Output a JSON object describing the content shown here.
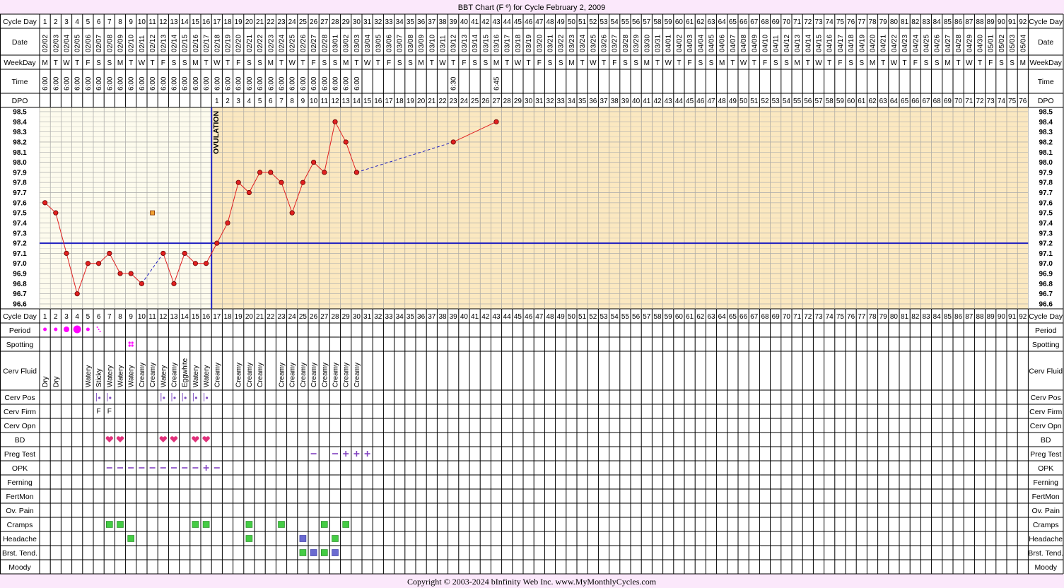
{
  "header": {
    "title": "BBT Chart (F º) for Cycle February 2, 2009"
  },
  "footer": {
    "copyright": "Copyright © 2003-2024 bInfinity Web Inc.    www.MyMonthlyCycles.com"
  },
  "row_labels": {
    "cycle_day": "Cycle Day",
    "date": "Date",
    "weekday": "WeekDay",
    "time": "Time",
    "dpo": "DPO",
    "period": "Period",
    "spotting": "Spotting",
    "cerv_fluid": "Cerv Fluid",
    "cerv_pos": "Cerv Pos",
    "cerv_firm": "Cerv Firm",
    "cerv_opn": "Cerv Opn",
    "bd": "BD",
    "preg_test": "Preg Test",
    "opk": "OPK",
    "ferning": "Ferning",
    "fertmon": "FertMon",
    "ov_pain": "Ov. Pain",
    "cramps": "Cramps",
    "headache": "Headache",
    "brst_tend": "Brst. Tend.",
    "moody": "Moody"
  },
  "ovulation_label": "OVULATION",
  "colors": {
    "background": "#fbe8fb",
    "preov_fill": "#fdfbed",
    "postov_fill": "#fbe8c0",
    "line": "#e02020",
    "coverline": "#2020c0",
    "period": "#ff00ff",
    "heart": "#e0307a",
    "symptom_green": "#44cc44",
    "symptom_blue": "#6a6ad0",
    "opk": "#8040c0"
  },
  "days": {
    "cycle_days": [
      1,
      2,
      3,
      4,
      5,
      6,
      7,
      8,
      9,
      10,
      11,
      12,
      13,
      14,
      15,
      16,
      17,
      18,
      19,
      20,
      21,
      22,
      23,
      24,
      25,
      26,
      27,
      28,
      29,
      30,
      31,
      32,
      33,
      34,
      35,
      36,
      37,
      38,
      39,
      40,
      41,
      42,
      43,
      44,
      45,
      46,
      47,
      48,
      49,
      50,
      51,
      52,
      53,
      54,
      55,
      56,
      57,
      58,
      59,
      60,
      61,
      62,
      63,
      64,
      65,
      66,
      67,
      68,
      69,
      70,
      71,
      72,
      73,
      74,
      75,
      76,
      77,
      78,
      79,
      80,
      81,
      82,
      83,
      84,
      85,
      86,
      87,
      88,
      89,
      90,
      91,
      92
    ],
    "dates": [
      "02/02",
      "02/03",
      "02/04",
      "02/05",
      "02/06",
      "02/07",
      "02/08",
      "02/09",
      "02/10",
      "02/11",
      "02/12",
      "02/13",
      "02/14",
      "02/15",
      "02/16",
      "02/17",
      "02/18",
      "02/19",
      "02/20",
      "02/21",
      "02/22",
      "02/23",
      "02/24",
      "02/25",
      "02/26",
      "02/27",
      "02/28",
      "03/01",
      "03/02",
      "03/03",
      "03/04",
      "03/05",
      "03/06",
      "03/07",
      "03/08",
      "03/09",
      "03/10",
      "03/11",
      "03/12",
      "03/13",
      "03/14",
      "03/15",
      "03/16",
      "03/17",
      "03/18",
      "03/19",
      "03/20",
      "03/21",
      "03/22",
      "03/23",
      "03/24",
      "03/25",
      "03/26",
      "03/27",
      "03/28",
      "03/29",
      "03/30",
      "03/31",
      "04/01",
      "04/02",
      "04/03",
      "04/04",
      "04/05",
      "04/06",
      "04/07",
      "04/08",
      "04/09",
      "04/10",
      "04/11",
      "04/12",
      "04/13",
      "04/14",
      "04/15",
      "04/16",
      "04/17",
      "04/18",
      "04/19",
      "04/20",
      "04/21",
      "04/22",
      "04/23",
      "04/24",
      "04/25",
      "04/26",
      "04/27",
      "04/28",
      "04/29",
      "04/30",
      "05/01",
      "05/02",
      "05/03",
      "05/04"
    ],
    "weekdays": [
      "M",
      "T",
      "W",
      "T",
      "F",
      "S",
      "S",
      "M",
      "T",
      "W",
      "T",
      "F",
      "S",
      "S",
      "M",
      "T",
      "W",
      "T",
      "F",
      "S",
      "S",
      "M",
      "T",
      "W",
      "T",
      "F",
      "S",
      "S",
      "M",
      "T",
      "W",
      "T",
      "F",
      "S",
      "S",
      "M",
      "T",
      "W",
      "T",
      "F",
      "S",
      "S",
      "M",
      "T",
      "W",
      "T",
      "F",
      "S",
      "S",
      "M",
      "T",
      "W",
      "T",
      "F",
      "S",
      "S",
      "M",
      "T",
      "W",
      "T",
      "F",
      "S",
      "S",
      "M",
      "T",
      "W",
      "T",
      "F",
      "S",
      "S",
      "M",
      "T",
      "W",
      "T",
      "F",
      "S",
      "S",
      "M",
      "T",
      "W",
      "T",
      "F",
      "S",
      "S",
      "M",
      "T",
      "W",
      "T",
      "F",
      "S",
      "S",
      "M"
    ],
    "times": [
      "6:00",
      "6:00",
      "6:00",
      "6:00",
      "6:00",
      "6:00",
      "6:00",
      "6:00",
      "6:00",
      "6:00",
      "6:00",
      "6:00",
      "6:00",
      "6:00",
      "6:00",
      "6:00",
      "6:00",
      "6:00",
      "6:00",
      "6:00",
      "6:00",
      "6:00",
      "6:00",
      "6:00",
      "6:00",
      "6:00",
      "6:00",
      "6:00",
      "6:00",
      "6:00",
      "",
      "",
      "",
      "",
      "",
      "",
      "",
      "",
      "6:30",
      "",
      "",
      "",
      "6:45"
    ],
    "dpo": [
      1,
      2,
      3,
      4,
      5,
      6,
      7,
      8,
      9,
      10,
      11,
      12,
      13,
      14,
      15,
      16,
      17,
      18,
      19,
      20,
      21,
      22,
      23,
      24,
      25,
      26,
      27,
      28,
      29,
      30,
      31,
      32,
      33,
      34,
      35,
      36,
      37,
      38,
      39,
      40,
      41,
      42,
      43,
      44,
      45,
      46,
      47,
      48,
      49,
      50,
      51,
      52,
      53,
      54,
      55,
      56,
      57,
      58,
      59,
      60,
      61,
      62,
      63,
      64,
      65,
      66,
      67,
      68,
      69,
      70,
      71,
      72,
      73,
      74,
      75,
      76
    ]
  },
  "chart_data": {
    "type": "line",
    "title": "BBT Chart (F º) for Cycle February 2, 2009",
    "x_label": "Cycle Day",
    "ylim": [
      96.6,
      98.5
    ],
    "y_ticks": [
      "98.5",
      "98.4",
      "98.3",
      "98.2",
      "98.1",
      "98.0",
      "97.9",
      "97.8",
      "97.7",
      "97.6",
      "97.5",
      "97.4",
      "97.3",
      "97.2",
      "97.1",
      "97.0",
      "96.9",
      "96.8",
      "96.7",
      "96.6"
    ],
    "ovulation_day": 16,
    "coverline": 97.2,
    "series": [
      {
        "x": [
          1,
          2,
          3,
          4,
          5,
          6,
          7,
          8,
          9,
          10
        ],
        "y": [
          97.6,
          97.5,
          97.1,
          96.7,
          97.0,
          97.0,
          97.1,
          96.9,
          96.9,
          96.8
        ]
      },
      {
        "x": [
          12,
          13,
          14,
          15,
          16,
          17,
          18,
          19,
          20,
          21,
          22,
          23,
          24,
          25,
          26,
          27,
          28,
          29,
          30
        ],
        "y": [
          97.1,
          96.8,
          97.1,
          97.0,
          97.0,
          97.2,
          97.4,
          97.8,
          97.7,
          97.9,
          97.9,
          97.8,
          97.5,
          97.8,
          98.0,
          97.9,
          98.4,
          98.2,
          97.9
        ]
      },
      {
        "x": [
          39,
          43
        ],
        "y": [
          98.2,
          98.4
        ]
      }
    ],
    "gap_lines": [
      {
        "from": [
          10,
          96.8
        ],
        "to": [
          12,
          97.1
        ]
      },
      {
        "from": [
          30,
          97.9
        ],
        "to": [
          39,
          98.2
        ]
      }
    ],
    "discarded": [
      {
        "x": 11,
        "y": 97.5
      }
    ]
  },
  "observations": {
    "period": [
      {
        "day": 1,
        "level": "light"
      },
      {
        "day": 2,
        "level": "light"
      },
      {
        "day": 3,
        "level": "medium"
      },
      {
        "day": 4,
        "level": "heavy"
      },
      {
        "day": 5,
        "level": "light"
      },
      {
        "day": 6,
        "level": "spotting"
      }
    ],
    "spotting": [
      9
    ],
    "cerv_fluid": [
      {
        "day": 1,
        "v": "Dry"
      },
      {
        "day": 2,
        "v": "Dry"
      },
      {
        "day": 5,
        "v": "Watery"
      },
      {
        "day": 6,
        "v": "Sticky"
      },
      {
        "day": 7,
        "v": "Watery"
      },
      {
        "day": 8,
        "v": "Watery"
      },
      {
        "day": 9,
        "v": "Watery"
      },
      {
        "day": 10,
        "v": "Creamy"
      },
      {
        "day": 11,
        "v": "Creamy"
      },
      {
        "day": 12,
        "v": "Watery"
      },
      {
        "day": 13,
        "v": "Creamy"
      },
      {
        "day": 14,
        "v": "Eggwhite"
      },
      {
        "day": 15,
        "v": "Watery"
      },
      {
        "day": 16,
        "v": "Watery"
      },
      {
        "day": 17,
        "v": "Creamy"
      },
      {
        "day": 19,
        "v": "Creamy"
      },
      {
        "day": 20,
        "v": "Creamy"
      },
      {
        "day": 21,
        "v": "Creamy"
      },
      {
        "day": 23,
        "v": "Creamy"
      },
      {
        "day": 24,
        "v": "Creamy"
      },
      {
        "day": 25,
        "v": "Creamy"
      },
      {
        "day": 26,
        "v": "Creamy"
      },
      {
        "day": 27,
        "v": "Creamy"
      },
      {
        "day": 28,
        "v": "Creamy"
      },
      {
        "day": 29,
        "v": "Creamy"
      },
      {
        "day": 30,
        "v": "Creamy"
      }
    ],
    "cerv_pos": [
      6,
      7,
      12,
      13,
      14,
      15,
      16
    ],
    "cerv_firm": [
      {
        "day": 6,
        "v": "F"
      },
      {
        "day": 7,
        "v": "F"
      }
    ],
    "bd": [
      7,
      8,
      12,
      13,
      15,
      16
    ],
    "preg_test": [
      {
        "day": 26,
        "v": "−"
      },
      {
        "day": 28,
        "v": "−"
      },
      {
        "day": 29,
        "v": "+"
      },
      {
        "day": 30,
        "v": "+"
      },
      {
        "day": 31,
        "v": "+"
      }
    ],
    "opk": [
      {
        "day": 7,
        "v": "−"
      },
      {
        "day": 8,
        "v": "−"
      },
      {
        "day": 9,
        "v": "−"
      },
      {
        "day": 10,
        "v": "−"
      },
      {
        "day": 11,
        "v": "−"
      },
      {
        "day": 12,
        "v": "−"
      },
      {
        "day": 13,
        "v": "−"
      },
      {
        "day": 14,
        "v": "−"
      },
      {
        "day": 15,
        "v": "−"
      },
      {
        "day": 16,
        "v": "+"
      },
      {
        "day": 17,
        "v": "−"
      }
    ],
    "cramps": [
      {
        "day": 7,
        "c": "g"
      },
      {
        "day": 8,
        "c": "g"
      },
      {
        "day": 15,
        "c": "g"
      },
      {
        "day": 16,
        "c": "g"
      },
      {
        "day": 20,
        "c": "g"
      },
      {
        "day": 23,
        "c": "g"
      },
      {
        "day": 27,
        "c": "g"
      },
      {
        "day": 29,
        "c": "g"
      }
    ],
    "headache": [
      {
        "day": 9,
        "c": "g"
      },
      {
        "day": 20,
        "c": "g"
      },
      {
        "day": 25,
        "c": "b"
      },
      {
        "day": 28,
        "c": "g"
      }
    ],
    "brst_tend": [
      {
        "day": 25,
        "c": "g"
      },
      {
        "day": 26,
        "c": "b"
      },
      {
        "day": 27,
        "c": "g"
      },
      {
        "day": 28,
        "c": "b"
      }
    ]
  }
}
